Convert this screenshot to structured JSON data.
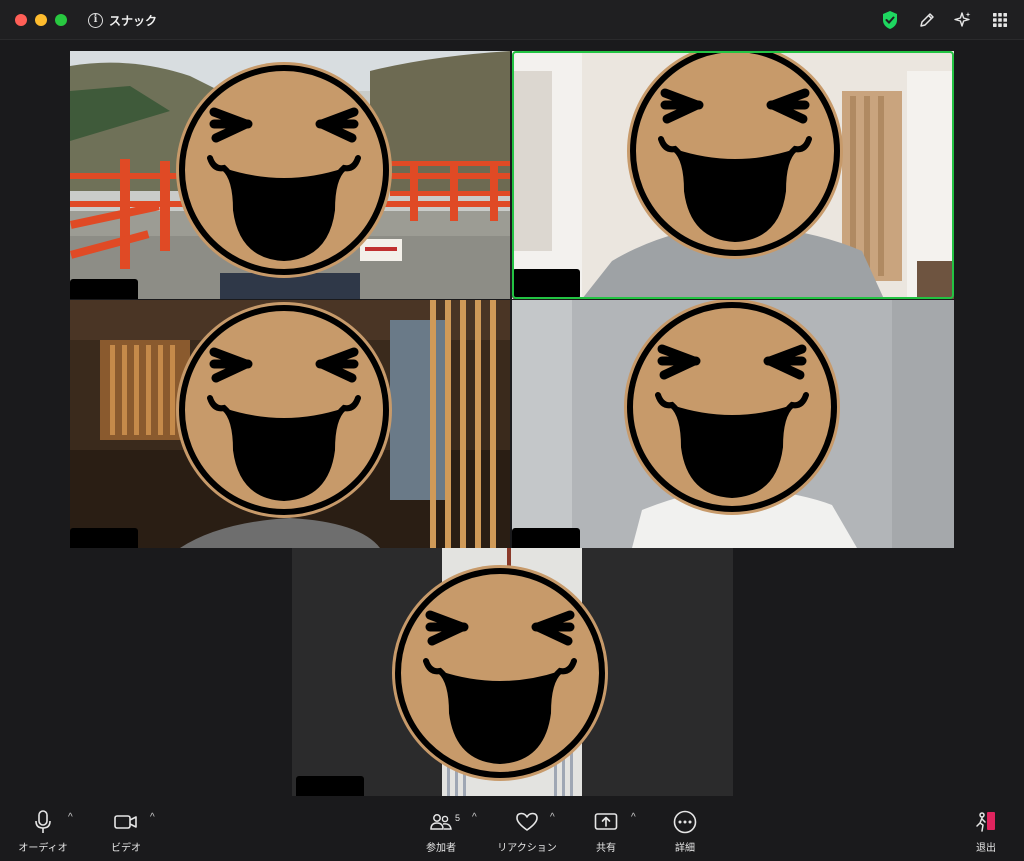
{
  "window": {
    "meeting_title": "スナック"
  },
  "toolbar": {
    "audio_label": "オーディオ",
    "video_label": "ビデオ",
    "participants_label": "参加者",
    "participants_count": "5",
    "reactions_label": "リアクション",
    "share_label": "共有",
    "more_label": "詳細",
    "leave_label": "退出"
  },
  "tiles": [
    {
      "scene": "shrine-bridge",
      "active": false
    },
    {
      "scene": "white-room",
      "active": true
    },
    {
      "scene": "wood-lounge",
      "active": false
    },
    {
      "scene": "grey-wall",
      "active": false
    },
    {
      "scene": "dark-room",
      "active": false
    }
  ],
  "colors": {
    "active_speaker": "#23c343",
    "security_shield": "#1ed760",
    "leave_accent": "#e0245e"
  }
}
